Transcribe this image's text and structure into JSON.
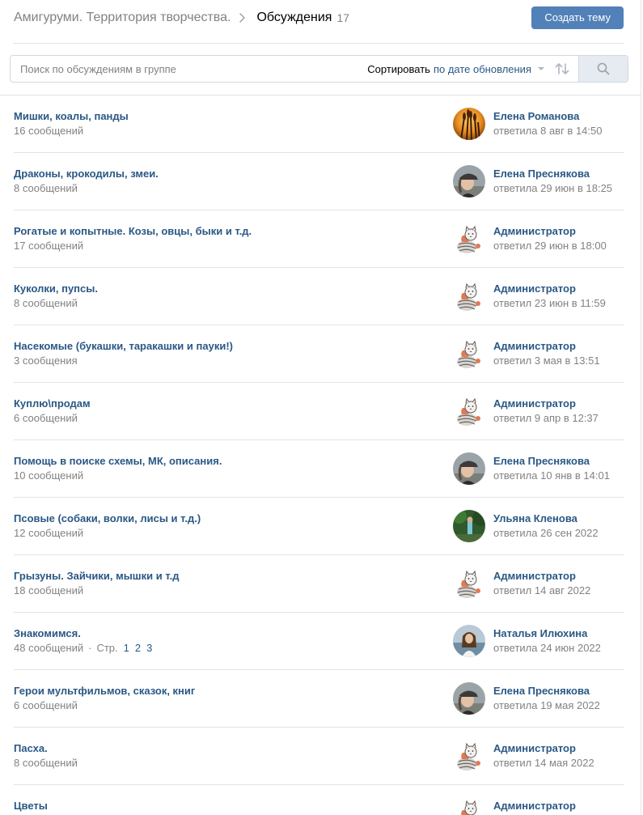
{
  "header": {
    "group_name": "Амигуруми. Территория творчества.",
    "section_title": "Обсуждения",
    "topic_count": "17",
    "create_button": "Создать тему"
  },
  "search": {
    "placeholder": "Поиск по обсуждениям в группе",
    "sort_label": "Сортировать",
    "sort_value": "по дате обновления"
  },
  "colors": {
    "accent": "#5181b8",
    "link": "#2a5885",
    "muted": "#828282",
    "divider": "#e1e3e6"
  },
  "topics": [
    {
      "title": "Мишки, коалы, панды",
      "messages": "16 сообщений",
      "author": "Елена Романова",
      "reply": "ответила 8 авг в 14:50",
      "avatar": "avatar-wheat-sunset"
    },
    {
      "title": "Драконы, крокодилы, змеи.",
      "messages": "8 сообщений",
      "author": "Елена Преснякова",
      "reply": "ответила 29 июн в 18:25",
      "avatar": "avatar-woman-cap"
    },
    {
      "title": "Рогатые и копытные. Козы, овцы, быки и т.д.",
      "messages": "17 сообщений",
      "author": "Администратор",
      "reply": "ответил 29 июн в 18:00",
      "avatar": "avatar-cat-yarn"
    },
    {
      "title": "Куколки, пупсы.",
      "messages": "8 сообщений",
      "author": "Администратор",
      "reply": "ответил 23 июн в 11:59",
      "avatar": "avatar-cat-yarn"
    },
    {
      "title": "Насекомые (букашки, таракашки и пауки!)",
      "messages": "3 сообщения",
      "author": "Администратор",
      "reply": "ответил 3 мая в 13:51",
      "avatar": "avatar-cat-yarn"
    },
    {
      "title": "Куплю\\продам",
      "messages": "6 сообщений",
      "author": "Администратор",
      "reply": "ответил 9 апр в 12:37",
      "avatar": "avatar-cat-yarn"
    },
    {
      "title": "Помощь в поиске схемы, МК, описания.",
      "messages": "10 сообщений",
      "author": "Елена Преснякова",
      "reply": "ответила 10 янв в 14:01",
      "avatar": "avatar-woman-cap"
    },
    {
      "title": "Псовые (собаки, волки, лисы и т.д.)",
      "messages": "12 сообщений",
      "author": "Ульяна Кленова",
      "reply": "ответила 26 сен 2022",
      "avatar": "avatar-girl-nature"
    },
    {
      "title": "Грызуны. Зайчики, мышки и т.д",
      "messages": "18 сообщений",
      "author": "Администратор",
      "reply": "ответил 14 авг 2022",
      "avatar": "avatar-cat-yarn"
    },
    {
      "title": "Знакомимся.",
      "messages": "48 сообщений",
      "pages_label": "Стр.",
      "pages": [
        "1",
        "2",
        "3"
      ],
      "author": "Наталья Илюхина",
      "reply": "ответила 24 июн 2022",
      "avatar": "avatar-woman-sea"
    },
    {
      "title": "Герои мультфильмов, сказок, книг",
      "messages": "6 сообщений",
      "author": "Елена Преснякова",
      "reply": "ответила 19 мая 2022",
      "avatar": "avatar-woman-cap"
    },
    {
      "title": "Пасха.",
      "messages": "8 сообщений",
      "author": "Администратор",
      "reply": "ответил 14 мая 2022",
      "avatar": "avatar-cat-yarn"
    },
    {
      "title": "Цветы",
      "messages": "",
      "author": "Администратор",
      "reply": "",
      "avatar": "avatar-cat-yarn"
    }
  ]
}
